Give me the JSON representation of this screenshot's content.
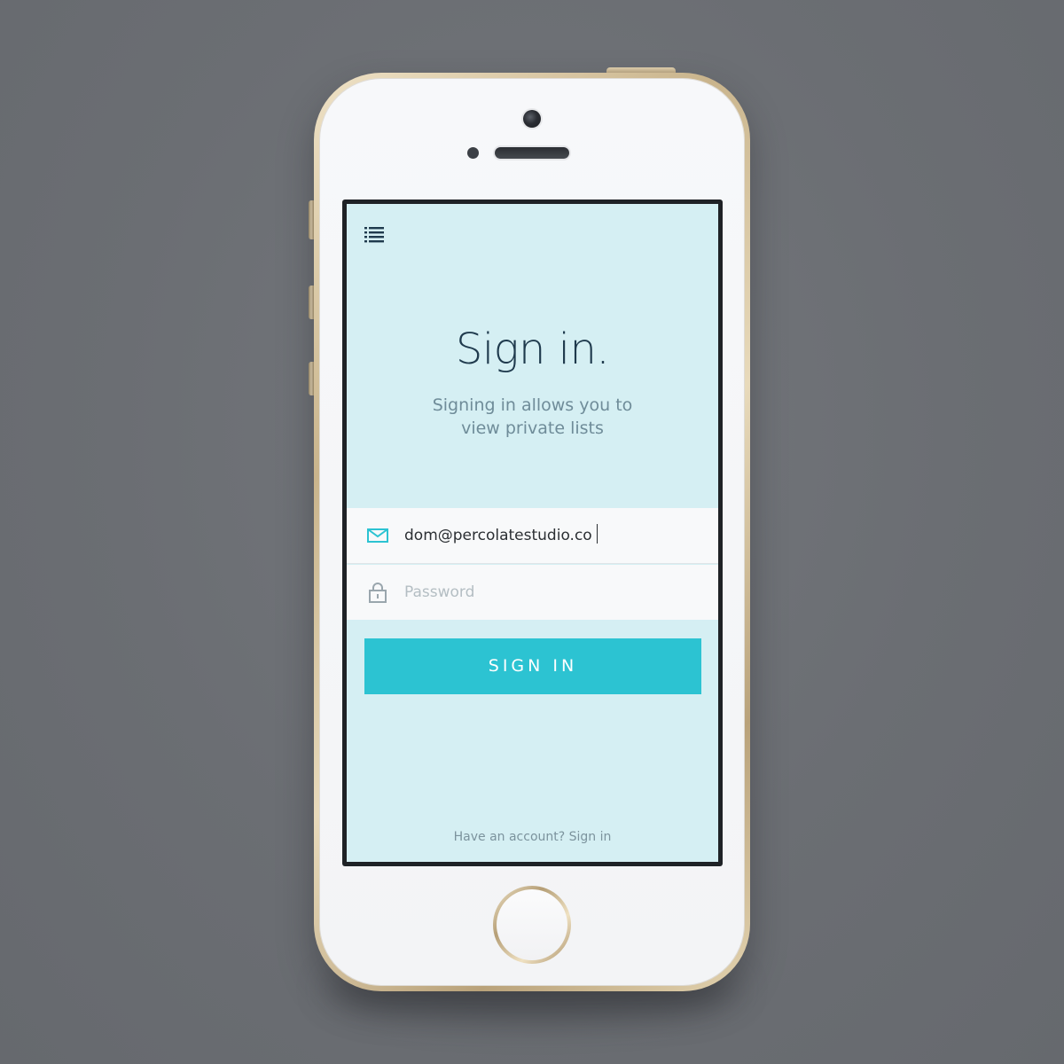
{
  "screen": {
    "menu_icon": "list-menu-icon",
    "title": "Sign in.",
    "subtitle_line1": "Signing in allows you to",
    "subtitle_line2": "view private lists",
    "email": {
      "icon": "envelope-icon",
      "value": "dom@percolatestudio.co"
    },
    "password": {
      "icon": "lock-icon",
      "placeholder": "Password"
    },
    "signin_button": "SIGN IN",
    "footer_text": "Have an account?",
    "footer_link": "Sign in"
  },
  "colors": {
    "screen_background": "#d5eff3",
    "accent": "#2cc3d2",
    "title": "#1f3a4d",
    "subtitle": "#6f8c99",
    "field_background": "#f8f9fa"
  }
}
